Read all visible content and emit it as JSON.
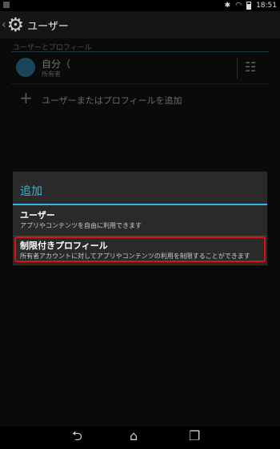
{
  "status_bar": {
    "time": "18:51"
  },
  "action_bar": {
    "title": "ユーザー"
  },
  "list": {
    "section_header": "ユーザーとプロフィール",
    "user": {
      "name": "自分（",
      "sub": "所有者"
    },
    "add_label": "ユーザーまたはプロフィールを追加"
  },
  "dialog": {
    "title": "追加",
    "options": [
      {
        "title": "ユーザー",
        "desc": "アプリやコンテンツを自由に利用できます"
      },
      {
        "title": "制限付きプロフィール",
        "desc": "所有者アカウントに対してアプリやコンテンツの利用を制限することができます"
      }
    ]
  },
  "colors": {
    "accent": "#33b5e5",
    "highlight": "#e01010"
  }
}
